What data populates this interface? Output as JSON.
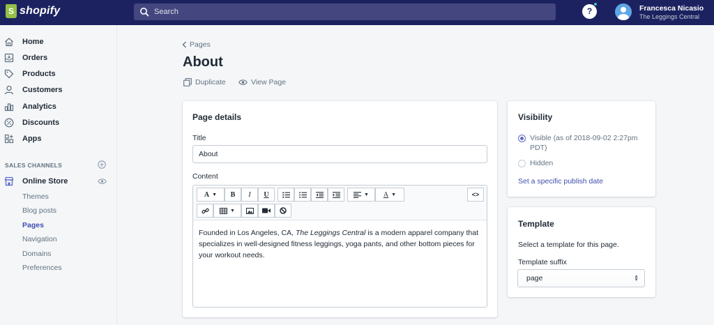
{
  "topbar": {
    "logo_text": "shopify",
    "search_placeholder": "Search",
    "help": "?",
    "user_name": "Francesca Nicasio",
    "user_store": "The Leggings Central"
  },
  "sidebar": {
    "items": [
      {
        "label": "Home",
        "icon": "home-icon"
      },
      {
        "label": "Orders",
        "icon": "orders-icon"
      },
      {
        "label": "Products",
        "icon": "tag-icon"
      },
      {
        "label": "Customers",
        "icon": "person-icon"
      },
      {
        "label": "Analytics",
        "icon": "bar-chart-icon"
      },
      {
        "label": "Discounts",
        "icon": "percent-icon"
      },
      {
        "label": "Apps",
        "icon": "apps-icon"
      }
    ],
    "channels_heading": "SALES CHANNELS",
    "online_store": "Online Store",
    "sub_items": [
      "Themes",
      "Blog posts",
      "Pages",
      "Navigation",
      "Domains",
      "Preferences"
    ],
    "active_sub_item": "Pages"
  },
  "main": {
    "breadcrumb": "Pages",
    "title": "About",
    "actions": {
      "duplicate": "Duplicate",
      "view": "View Page"
    }
  },
  "page_details": {
    "heading": "Page details",
    "title_label": "Title",
    "title_value": "About",
    "content_label": "Content",
    "toolbar_labels": {
      "bold": "B",
      "italic": "I",
      "underline": "U",
      "code": "<>"
    },
    "content_parts": {
      "before": "Founded in Los Angeles, CA, ",
      "italic": "The Leggings Central",
      "after": " is a modern apparel company that specializes in well-designed fitness leggings, yoga pants, and other bottom pieces for your workout needs."
    }
  },
  "visibility": {
    "heading": "Visibility",
    "visible_label": "Visible (as of 2018-09-02 2:27pm PDT)",
    "hidden_label": "Hidden",
    "selected": "visible",
    "publish_link": "Set a specific publish date"
  },
  "template": {
    "heading": "Template",
    "description": "Select a template for this page.",
    "suffix_label": "Template suffix",
    "suffix_value": "page"
  },
  "colors": {
    "topbar": "#1c2260",
    "accent": "#5c6ac4",
    "link": "#3f4eae"
  }
}
